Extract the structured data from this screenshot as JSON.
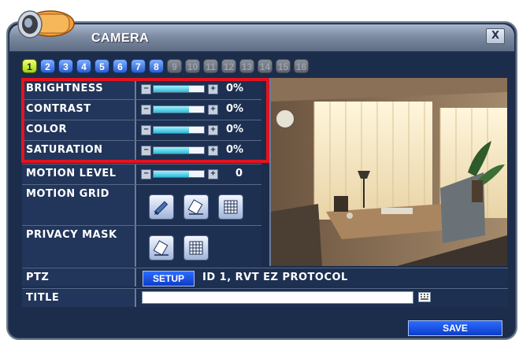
{
  "window": {
    "title": "CAMERA",
    "close_label": "X"
  },
  "channels": [
    {
      "label": "1",
      "state": "selected"
    },
    {
      "label": "2",
      "state": "active"
    },
    {
      "label": "3",
      "state": "active"
    },
    {
      "label": "4",
      "state": "active"
    },
    {
      "label": "5",
      "state": "active"
    },
    {
      "label": "6",
      "state": "active"
    },
    {
      "label": "7",
      "state": "active"
    },
    {
      "label": "8",
      "state": "active"
    },
    {
      "label": "9",
      "state": "disabled"
    },
    {
      "label": "10",
      "state": "disabled"
    },
    {
      "label": "11",
      "state": "disabled"
    },
    {
      "label": "12",
      "state": "disabled"
    },
    {
      "label": "13",
      "state": "disabled"
    },
    {
      "label": "14",
      "state": "disabled"
    },
    {
      "label": "15",
      "state": "disabled"
    },
    {
      "label": "16",
      "state": "disabled"
    }
  ],
  "settings": {
    "brightness": {
      "label": "BRIGHTNESS",
      "value": "0%",
      "level": 0.7
    },
    "contrast": {
      "label": "CONTRAST",
      "value": "0%",
      "level": 0.7
    },
    "color": {
      "label": "COLOR",
      "value": "0%",
      "level": 0.7
    },
    "saturation": {
      "label": "SATURATION",
      "value": "0%",
      "level": 0.7
    },
    "motion_level": {
      "label": "MOTION LEVEL",
      "value": "0",
      "level": 0.7
    },
    "motion_grid": {
      "label": "MOTION GRID"
    },
    "privacy_mask": {
      "label": "PRIVACY MASK"
    }
  },
  "ptz": {
    "label": "PTZ",
    "setup_label": "SETUP",
    "info": "ID 1, RVT EZ PROTOCOL"
  },
  "title_row": {
    "label": "TITLE",
    "value": ""
  },
  "save_label": "SAVE",
  "colors": {
    "highlight": "#e3131f",
    "panel": "#1b2d4a",
    "tab_selected": "#c6ee3a",
    "tab_active": "#2c5fd0"
  }
}
